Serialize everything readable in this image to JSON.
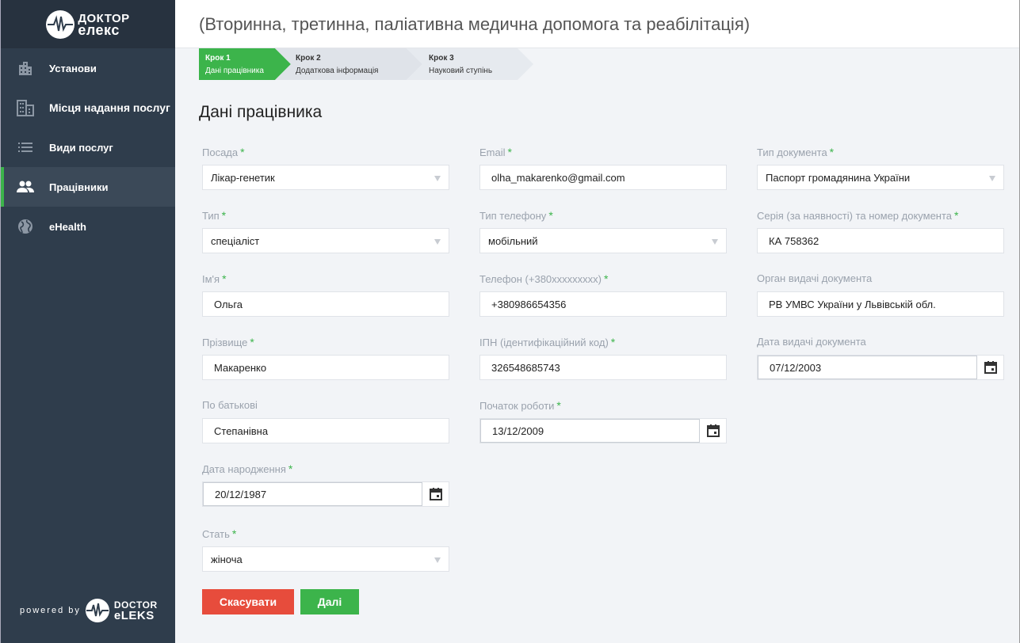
{
  "brand": {
    "logo_line1": "ДОКТОР",
    "logo_line2": "елекс",
    "powered_by": "powered by",
    "footer_line1": "DOCTOR",
    "footer_line2": "eLEKS"
  },
  "sidebar": {
    "items": [
      {
        "label": "Установи",
        "icon": "building-icon"
      },
      {
        "label": "Місця надання послуг",
        "icon": "office-icon"
      },
      {
        "label": "Види послуг",
        "icon": "list-icon"
      },
      {
        "label": "Працівники",
        "icon": "people-icon",
        "active": true
      },
      {
        "label": "eHealth",
        "icon": "globe-icon"
      }
    ]
  },
  "header": {
    "title": "(Вторинна, третинна, паліативна медична допомога та реабілітація)"
  },
  "steps": [
    {
      "step": "Крок 1",
      "label": "Дані працівника"
    },
    {
      "step": "Крок 2",
      "label": "Додаткова інформація"
    },
    {
      "step": "Крок 3",
      "label": "Науковий ступінь"
    }
  ],
  "form": {
    "title": "Дані працівника",
    "required_mark": "*",
    "position": {
      "label": "Посада",
      "value": "Лікар-генетик"
    },
    "type": {
      "label": "Тип",
      "value": "спеціаліст"
    },
    "first_name": {
      "label": "Ім'я",
      "value": "Ольга"
    },
    "last_name": {
      "label": "Прізвище",
      "value": "Макаренко"
    },
    "patronymic": {
      "label": "По батькові",
      "value": "Степанівна"
    },
    "birth_date": {
      "label": "Дата народження",
      "value": "20/12/1987"
    },
    "gender": {
      "label": "Стать",
      "value": "жіноча"
    },
    "email": {
      "label": "Email",
      "value": "olha_makarenko@gmail.com"
    },
    "phone_type": {
      "label": "Тип телефону",
      "value": "мобільний"
    },
    "phone": {
      "label": "Телефон (+380xxxxxxxxx)",
      "value": "+380986654356"
    },
    "tax_id": {
      "label": "ІПН (ідентифікаційний код)",
      "value": "326548685743"
    },
    "start_date": {
      "label": "Початок роботи",
      "value": "13/12/2009"
    },
    "doc_type": {
      "label": "Тип документа",
      "value": "Паспорт громадянина України"
    },
    "doc_number": {
      "label": "Серія (за наявності) та номер документа",
      "value": "КА 758362"
    },
    "doc_issuer": {
      "label": "Орган видачі документа",
      "value": "РВ УМВС України у Львівській обл."
    },
    "doc_date": {
      "label": "Дата видачі документа",
      "value": "07/12/2003"
    }
  },
  "buttons": {
    "cancel": "Скасувати",
    "next": "Далі"
  },
  "colors": {
    "accent": "#3cb44b",
    "danger": "#e74c3c",
    "sidebar": "#2f3d4c"
  }
}
